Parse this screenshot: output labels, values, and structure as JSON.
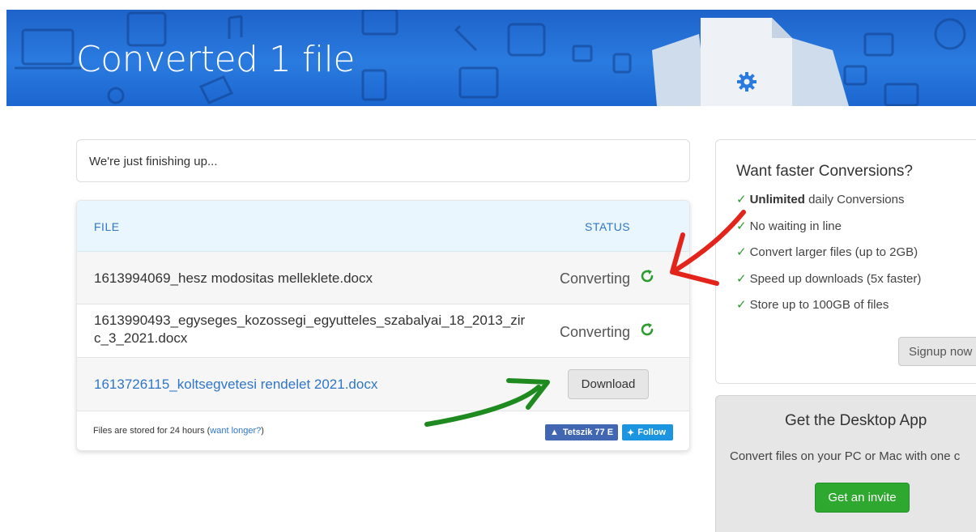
{
  "banner": {
    "title": "Converted 1 file"
  },
  "status": {
    "message": "We're just finishing up..."
  },
  "table": {
    "headers": {
      "file": "FILE",
      "status": "STATUS"
    },
    "rows": [
      {
        "filename": "1613994069_hesz modositas melleklete.docx",
        "state": "Converting"
      },
      {
        "filename_line1": "1613990493_egyseges_kozossegi_egyutteles_szabalyai_18_2013_zir",
        "filename_line2": "c_3_2021.docx",
        "state": "Converting"
      },
      {
        "filename": "1613726115_koltsegvetesi rendelet 2021.docx",
        "action": "Download"
      }
    ],
    "footer": {
      "note": "Files are stored for 24 hours (",
      "link": "want longer?",
      "close": ")"
    },
    "social": {
      "facebook": "Tetszik 77 E",
      "twitter": "Follow"
    }
  },
  "upsell": {
    "title": "Want faster Conversions?",
    "features": [
      {
        "bold": "Unlimited",
        "text": " daily Conversions"
      },
      {
        "text": "No waiting in line"
      },
      {
        "text": "Convert larger files (up to 2GB)"
      },
      {
        "text": "Speed up downloads (5x faster)"
      },
      {
        "text": "Store up to 100GB of files"
      }
    ],
    "check": "✓",
    "signup_label": "Signup now"
  },
  "desktop": {
    "title": "Get the Desktop App",
    "text": "Convert files on your PC or Mac with one c",
    "invite_label": "Get an invite"
  },
  "colors": {
    "banner": "#2a7be0",
    "link": "#2f76c7",
    "success": "#2ea82e",
    "annotation_red": "#e3241b",
    "annotation_green": "#1f8a1f"
  }
}
